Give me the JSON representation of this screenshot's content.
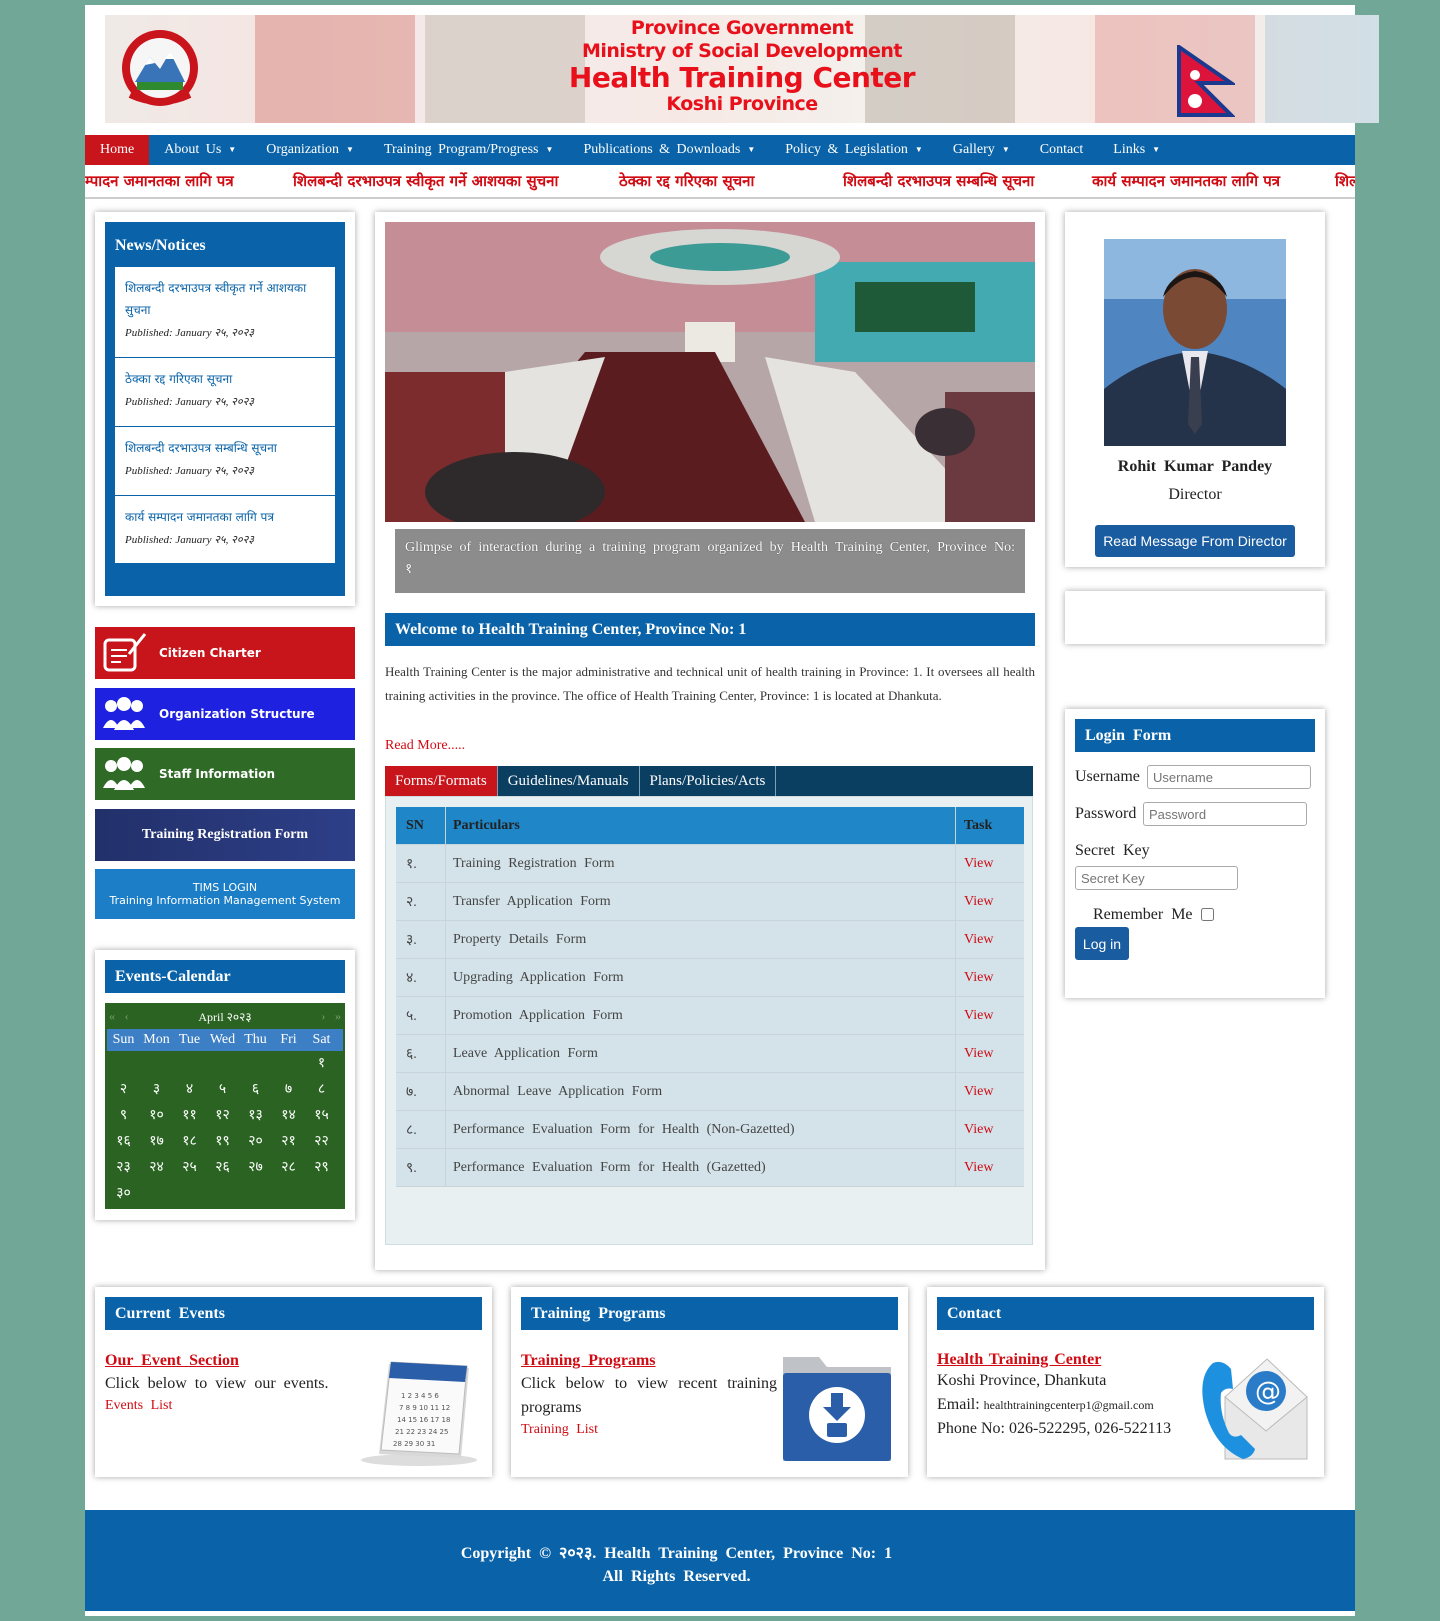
{
  "banner": {
    "line1": "Province Government",
    "line2": "Ministry of Social Development",
    "line3": "Health Training Center",
    "line4": "Koshi Province"
  },
  "nav": {
    "items": [
      {
        "label": "Home"
      },
      {
        "label": "About Us"
      },
      {
        "label": "Organization"
      },
      {
        "label": "Training Program/Progress"
      },
      {
        "label": "Publications & Downloads"
      },
      {
        "label": "Policy & Legislation"
      },
      {
        "label": "Gallery"
      },
      {
        "label": "Contact"
      },
      {
        "label": "Links"
      }
    ]
  },
  "ticker": [
    "म्पादन जमानतका लागि पत्र",
    "शिलबन्दी दरभाउपत्र स्वीकृत गर्ने आशयका सुचना",
    "ठेक्का रद्द गरिएका सूचना",
    "शिलबन्दी दरभाउपत्र सम्बन्धि सूचना",
    "कार्य सम्पादन जमानतका लागि पत्र",
    "शिल"
  ],
  "news": {
    "title": "News/Notices",
    "items": [
      {
        "title": "शिलबन्दी दरभाउपत्र स्वीकृत गर्ने आशयका सुचना",
        "published": "Published: January २५, २०२३"
      },
      {
        "title": "ठेक्का रद्द गरिएका सूचना",
        "published": "Published: January २५, २०२३"
      },
      {
        "title": "शिलबन्दी दरभाउपत्र सम्बन्धि सूचना",
        "published": "Published: January २५, २०२३"
      },
      {
        "title": "कार्य सम्पादन जमानतका लागि पत्र",
        "published": "Published: January २५, २०२३"
      }
    ]
  },
  "quick_links": {
    "citizen_charter": "Citizen Charter",
    "org_structure": "Organization Structure",
    "staff_info": "Staff Information",
    "training_reg": "Training Registration Form",
    "tims_line1": "TIMS LOGIN",
    "tims_line2": "Training Information Management System"
  },
  "calendar": {
    "title": "Events-Calendar",
    "month": "April २०२३",
    "weekdays": [
      "Sun",
      "Mon",
      "Tue",
      "Wed",
      "Thu",
      "Fri",
      "Sat"
    ],
    "weeks": [
      [
        "",
        "",
        "",
        "",
        "",
        "",
        "१"
      ],
      [
        "२",
        "३",
        "४",
        "५",
        "६",
        "७",
        "८"
      ],
      [
        "९",
        "१०",
        "११",
        "१२",
        "१३",
        "१४",
        "१५"
      ],
      [
        "१६",
        "१७",
        "१८",
        "१९",
        "२०",
        "२१",
        "२२"
      ],
      [
        "२३",
        "२४",
        "२५",
        "२६",
        "२७",
        "२८",
        "२९"
      ],
      [
        "३०",
        "",
        "",
        "",
        "",
        "",
        ""
      ]
    ]
  },
  "slider": {
    "caption": "Glimpse of interaction during a training program organized by Health Training Center, Province No: १"
  },
  "welcome": {
    "title": "Welcome to Health Training Center, Province No: 1",
    "body": "Health Training Center is the major administrative and technical unit of health training in Province: 1. It oversees all health training activities in the province. The office of Health Training Center, Province: 1 is located at Dhankuta.",
    "read_more": "Read More....."
  },
  "tabs": [
    "Forms/Formats",
    "Guidelines/Manuals",
    "Plans/Policies/Acts"
  ],
  "forms_table": {
    "headers": [
      "SN",
      "Particulars",
      "Task"
    ],
    "rows": [
      [
        "१.",
        "Training Registration Form",
        "View"
      ],
      [
        "२.",
        "Transfer Application Form",
        "View"
      ],
      [
        "३.",
        "Property Details Form",
        "View"
      ],
      [
        "४.",
        "Upgrading Application Form",
        "View"
      ],
      [
        "५.",
        "Promotion Application Form",
        "View"
      ],
      [
        "६.",
        "Leave Application Form",
        "View"
      ],
      [
        "७.",
        "Abnormal Leave Application Form",
        "View"
      ],
      [
        "८.",
        "Performance Evaluation Form for Health (Non-Gazetted)",
        "View"
      ],
      [
        "९.",
        "Performance Evaluation Form for Health (Gazetted)",
        "View"
      ]
    ]
  },
  "director": {
    "name": "Rohit Kumar Pandey",
    "role": "Director",
    "button": "Read Message From Director"
  },
  "login": {
    "title": "Login Form",
    "username_label": "Username",
    "username_placeholder": "Username",
    "password_label": "Password",
    "password_placeholder": "Password",
    "secret_label": "Secret Key",
    "secret_placeholder": "Secret Key",
    "remember_label": "Remember Me",
    "submit": "Log in"
  },
  "current_events": {
    "title": "Current Events",
    "link": "Our Event Section",
    "text": "Click below to view our events.",
    "small": "Events List"
  },
  "training_programs": {
    "title": "Training Programs",
    "link": "Training Programs",
    "text": "Click below to view recent training programs",
    "small": "Training List"
  },
  "contact": {
    "title": "Contact",
    "org": "Health Training Center",
    "address": "Koshi Province, Dhankuta",
    "email_label": "Email:",
    "email": "healthtrainingcenterp1@gmail.com",
    "phone": "Phone No: 026-522295, 026-522113"
  },
  "footer": {
    "line1": "Copyright © २०२३. Health Training Center, Province No: 1",
    "line2": "All Rights Reserved."
  },
  "colors": {
    "accent_blue": "#0a63a8",
    "accent_red": "#c8141b",
    "page_bg": "#71a797",
    "calendar_green": "#2a6322"
  }
}
